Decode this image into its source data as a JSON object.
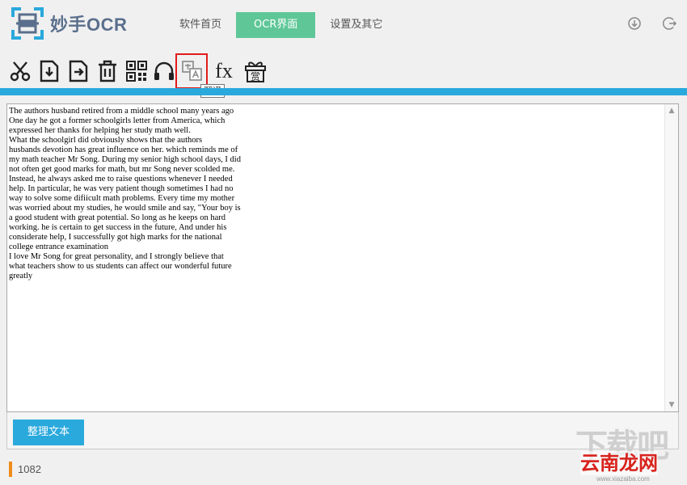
{
  "header": {
    "app_name": "妙手OCR",
    "tabs": [
      {
        "label": "软件首页",
        "active": false
      },
      {
        "label": "OCR界面",
        "active": true
      },
      {
        "label": "设置及其它",
        "active": false
      }
    ],
    "icons": [
      "download-icon",
      "logout-icon"
    ]
  },
  "toolbar": {
    "tools": [
      "scissors-icon",
      "import-icon",
      "export-icon",
      "trash-icon",
      "qrcode-icon",
      "headphones-icon",
      "translate-icon",
      "formula-icon",
      "reward-icon"
    ],
    "formula_label": "fx",
    "reward_label": "赏",
    "tooltip": "翻译"
  },
  "editor": {
    "text": "The authors husband retired from a middle school many years ago\nOne day he got a former schoolgirls letter from America, which\nexpressed her thanks for helping her study math well.\nWhat the schoolgirl did obviously shows that the authors\nhusbands devotion has great influence on her. which reminds me of\nmy math teacher Mr Song. During my senior high school days, I did\nnot often get good marks for math, but mr Song never scolded me.\nInstead, he always asked me to raise questions whenever I needed\nhelp. In particular, he was very patient though sometimes I had no\nway to solve some difiicult math problems. Every time my mother\nwas worried about my studies, he would smile and say, \"Your boy is\na good student with great potential. So long as he keeps on hard\nworking. he is certain to get success in the future, And under his\nconsiderate help, I successfully got high marks for the national\ncollege entrance examination\nI love Mr Song for great personality, and I strongly believe that\nwhat teachers show to us students can affect our wonderful future\ngreatly"
  },
  "actions": {
    "tidy_label": "整理文本"
  },
  "status": {
    "count": "1082"
  },
  "watermark": {
    "big": "下载吧",
    "red": "云南龙网",
    "url": "www.xiazaiba.com"
  },
  "colors": {
    "accent_green": "#5fc797",
    "accent_blue": "#2aa9dc",
    "highlight_red": "#e21b1b",
    "status_orange": "#f08c1a"
  }
}
